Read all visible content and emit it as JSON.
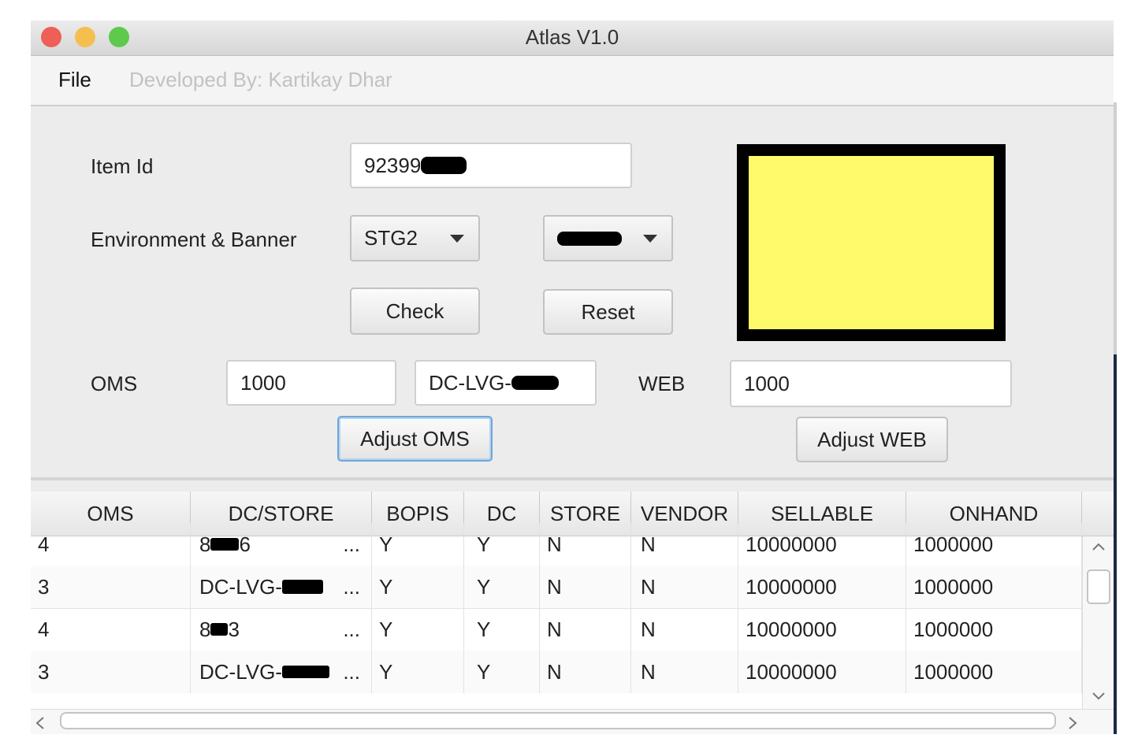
{
  "window": {
    "title": "Atlas V1.0",
    "traffic_lights": {
      "close": "#ee5f57",
      "minimize": "#f4bf4f",
      "zoom": "#5ec94b"
    }
  },
  "menu": {
    "file": "File",
    "developer_credit": "Developed By: Kartikay Dhar"
  },
  "form": {
    "item_id_label": "Item Id",
    "item_id_value": "92399",
    "env_banner_label": "Environment & Banner",
    "environment": "STG2",
    "check_label": "Check",
    "reset_label": "Reset",
    "oms_label": "OMS",
    "oms_value": "1000",
    "oms_dc_value": "DC-LVG-",
    "web_label": "WEB",
    "web_value": "1000",
    "adjust_oms_label": "Adjust OMS",
    "adjust_web_label": "Adjust WEB",
    "status_color": "#fffa6b"
  },
  "table": {
    "columns": [
      "OMS",
      "DC/STORE",
      "BOPIS",
      "DC",
      "STORE",
      "VENDOR",
      "SELLABLE",
      "ONHAND"
    ],
    "rows": [
      {
        "oms": "4",
        "dc_store_a": "8",
        "dc_store_b": "6",
        "bopis": "Y",
        "dc": "Y",
        "store": "N",
        "vendor": "N",
        "sellable": "10000000",
        "onhand": "1000000"
      },
      {
        "oms": "3",
        "dc_store_a": "DC-LVG-",
        "dc_store_b": "",
        "bopis": "Y",
        "dc": "Y",
        "store": "N",
        "vendor": "N",
        "sellable": "10000000",
        "onhand": "1000000"
      },
      {
        "oms": "4",
        "dc_store_a": "8",
        "dc_store_b": "3",
        "bopis": "Y",
        "dc": "Y",
        "store": "N",
        "vendor": "N",
        "sellable": "10000000",
        "onhand": "1000000"
      },
      {
        "oms": "3",
        "dc_store_a": "DC-LVG-",
        "dc_store_b": "",
        "bopis": "Y",
        "dc": "Y",
        "store": "N",
        "vendor": "N",
        "sellable": "10000000",
        "onhand": "1000000"
      }
    ],
    "ellipsis": "..."
  }
}
